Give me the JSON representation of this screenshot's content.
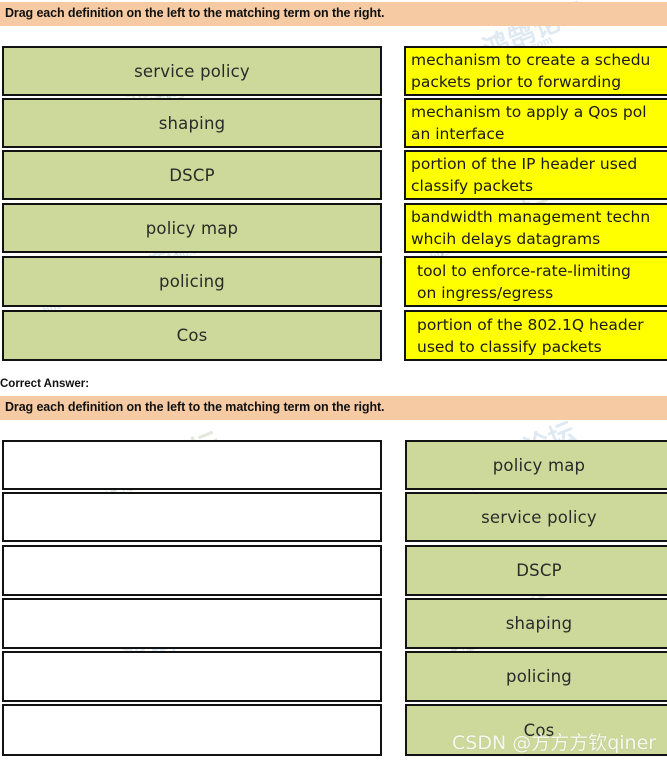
{
  "question": {
    "instruction": "Drag each definition on the left to the matching term on the right.",
    "correct_answer_label": "Correct Answer:"
  },
  "question_panel": {
    "terms": [
      {
        "label": "service policy"
      },
      {
        "label": "shaping"
      },
      {
        "label": "DSCP"
      },
      {
        "label": "policy map"
      },
      {
        "label": "policing"
      },
      {
        "label": "Cos"
      }
    ],
    "definitions": [
      {
        "line1": "mechanism to create a schedu",
        "line2": "packets prior to forwarding"
      },
      {
        "line1": "mechanism to apply a Qos pol",
        "line2": "an interface"
      },
      {
        "line1": "portion of the IP header used",
        "line2": "classify packets"
      },
      {
        "line1": "bandwidth management techn",
        "line2": "whcih delays datagrams"
      },
      {
        "line1": "tool to enforce-rate-limiting",
        "line2": "on ingress/egress"
      },
      {
        "line1": "portion of the 802.1Q header",
        "line2": "used to classify packets"
      }
    ]
  },
  "answer_panel": {
    "drop_slots": [
      {
        "label": ""
      },
      {
        "label": ""
      },
      {
        "label": ""
      },
      {
        "label": ""
      },
      {
        "label": ""
      },
      {
        "label": ""
      }
    ],
    "terms": [
      {
        "label": "policy map"
      },
      {
        "label": "service policy"
      },
      {
        "label": "DSCP"
      },
      {
        "label": "shaping"
      },
      {
        "label": "policing"
      },
      {
        "label": "Cos"
      }
    ]
  },
  "watermarks": {
    "csdn": "CSDN @方方方钦qiner",
    "site": "bbs.hh0l0.com",
    "brand": "鸿鹄论坛"
  },
  "colors": {
    "banner": "#f6cba4",
    "term_green": "#ccd99a",
    "definition_yellow": "#ffff00",
    "border": "#121212"
  }
}
